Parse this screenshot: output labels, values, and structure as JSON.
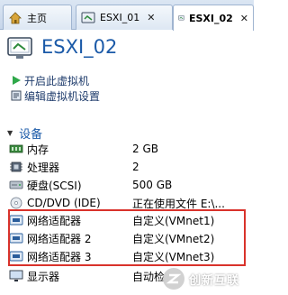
{
  "tabs": [
    {
      "label": "主页",
      "close": ""
    },
    {
      "label": "ESXI_01",
      "close": "✕"
    },
    {
      "label": "ESXI_02",
      "close": "✕"
    }
  ],
  "vm": {
    "title": "ESXI_02"
  },
  "actions": [
    {
      "label": "开启此虚拟机",
      "icon": "play-icon"
    },
    {
      "label": "编辑虚拟机设置",
      "icon": "edit-settings-icon"
    }
  ],
  "devices": {
    "title": "设备",
    "items": [
      {
        "name": "内存",
        "value": "2 GB",
        "icon": "memory-icon"
      },
      {
        "name": "处理器",
        "value": "2",
        "icon": "processor-icon"
      },
      {
        "name": "硬盘(SCSI)",
        "value": "500 GB",
        "icon": "hard-disk-icon"
      },
      {
        "name": "CD/DVD (IDE)",
        "value": "正在使用文件 E:\\...",
        "icon": "cd-dvd-icon"
      },
      {
        "name": "网络适配器",
        "value": "自定义(VMnet1)",
        "icon": "network-adapter-icon"
      },
      {
        "name": "网络适配器 2",
        "value": "自定义(VMnet2)",
        "icon": "network-adapter-icon"
      },
      {
        "name": "网络适配器 3",
        "value": "自定义(VMnet3)",
        "icon": "network-adapter-icon"
      },
      {
        "name": "显示器",
        "value": "自动检",
        "icon": "display-icon"
      }
    ]
  },
  "watermark": {
    "text": "创新互联"
  },
  "colors": {
    "accent": "#1b5aa8",
    "highlight": "#d9322b"
  }
}
